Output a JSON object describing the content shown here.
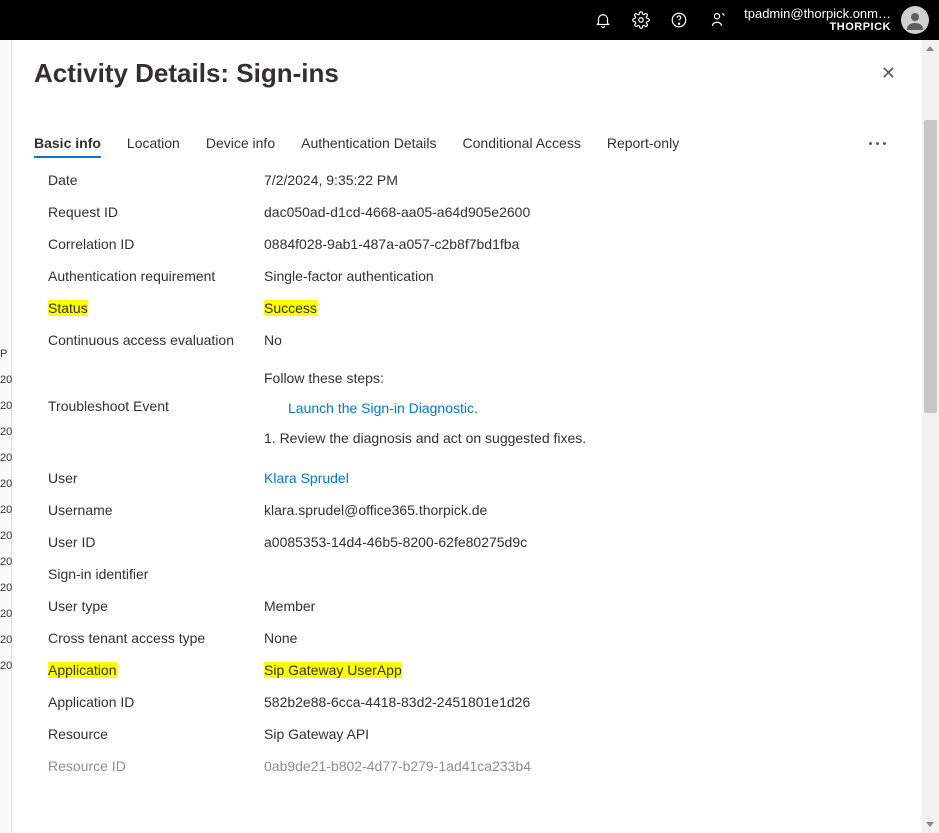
{
  "topbar": {
    "user_email": "tpadmin@thorpick.onm…",
    "user_tenant": "THORPICK"
  },
  "panel": {
    "title": "Activity Details: Sign-ins"
  },
  "tabs": [
    {
      "label": "Basic info",
      "active": true
    },
    {
      "label": "Location",
      "active": false
    },
    {
      "label": "Device info",
      "active": false
    },
    {
      "label": "Authentication Details",
      "active": false
    },
    {
      "label": "Conditional Access",
      "active": false
    },
    {
      "label": "Report-only",
      "active": false
    }
  ],
  "rows": {
    "date_label": "Date",
    "date_value": "7/2/2024, 9:35:22 PM",
    "req_label": "Request ID",
    "req_value": "dac050ad-d1cd-4668-aa05-a64d905e2600",
    "corr_label": "Correlation ID",
    "corr_value": "0884f028-9ab1-487a-a057-c2b8f7bd1fba",
    "authreq_label": "Authentication requirement",
    "authreq_value": "Single-factor authentication",
    "status_label": "Status",
    "status_value": "Success",
    "cae_label": "Continuous access evaluation",
    "cae_value": "No",
    "tshoot_label": "Troubleshoot Event",
    "tshoot_header": "Follow these steps:",
    "tshoot_link": "Launch the Sign-in Diagnostic.",
    "tshoot_step1": "1. Review the diagnosis and act on suggested fixes.",
    "user_label": "User",
    "user_value": "Klara Sprudel",
    "username_label": "Username",
    "username_value": "klara.sprudel@office365.thorpick.de",
    "userid_label": "User ID",
    "userid_value": "a0085353-14d4-46b5-8200-62fe80275d9c",
    "signinid_label": "Sign-in identifier",
    "signinid_value": "",
    "usertype_label": "User type",
    "usertype_value": "Member",
    "ctat_label": "Cross tenant access type",
    "ctat_value": "None",
    "app_label": "Application",
    "app_value": "Sip Gateway UserApp",
    "appid_label": "Application ID",
    "appid_value": "582b2e88-6cca-4418-83d2-2451801e1d26",
    "resource_label": "Resource",
    "resource_value": "Sip Gateway API",
    "resourceid_label": "Resource ID",
    "resourceid_value": "0ab9de21-b802-4d77-b279-1ad41ca233b4"
  },
  "left_numbers": [
    "P",
    "20",
    "20",
    "20",
    "20",
    "20",
    "20",
    "20",
    "20",
    "20",
    "20",
    "20",
    "20"
  ]
}
